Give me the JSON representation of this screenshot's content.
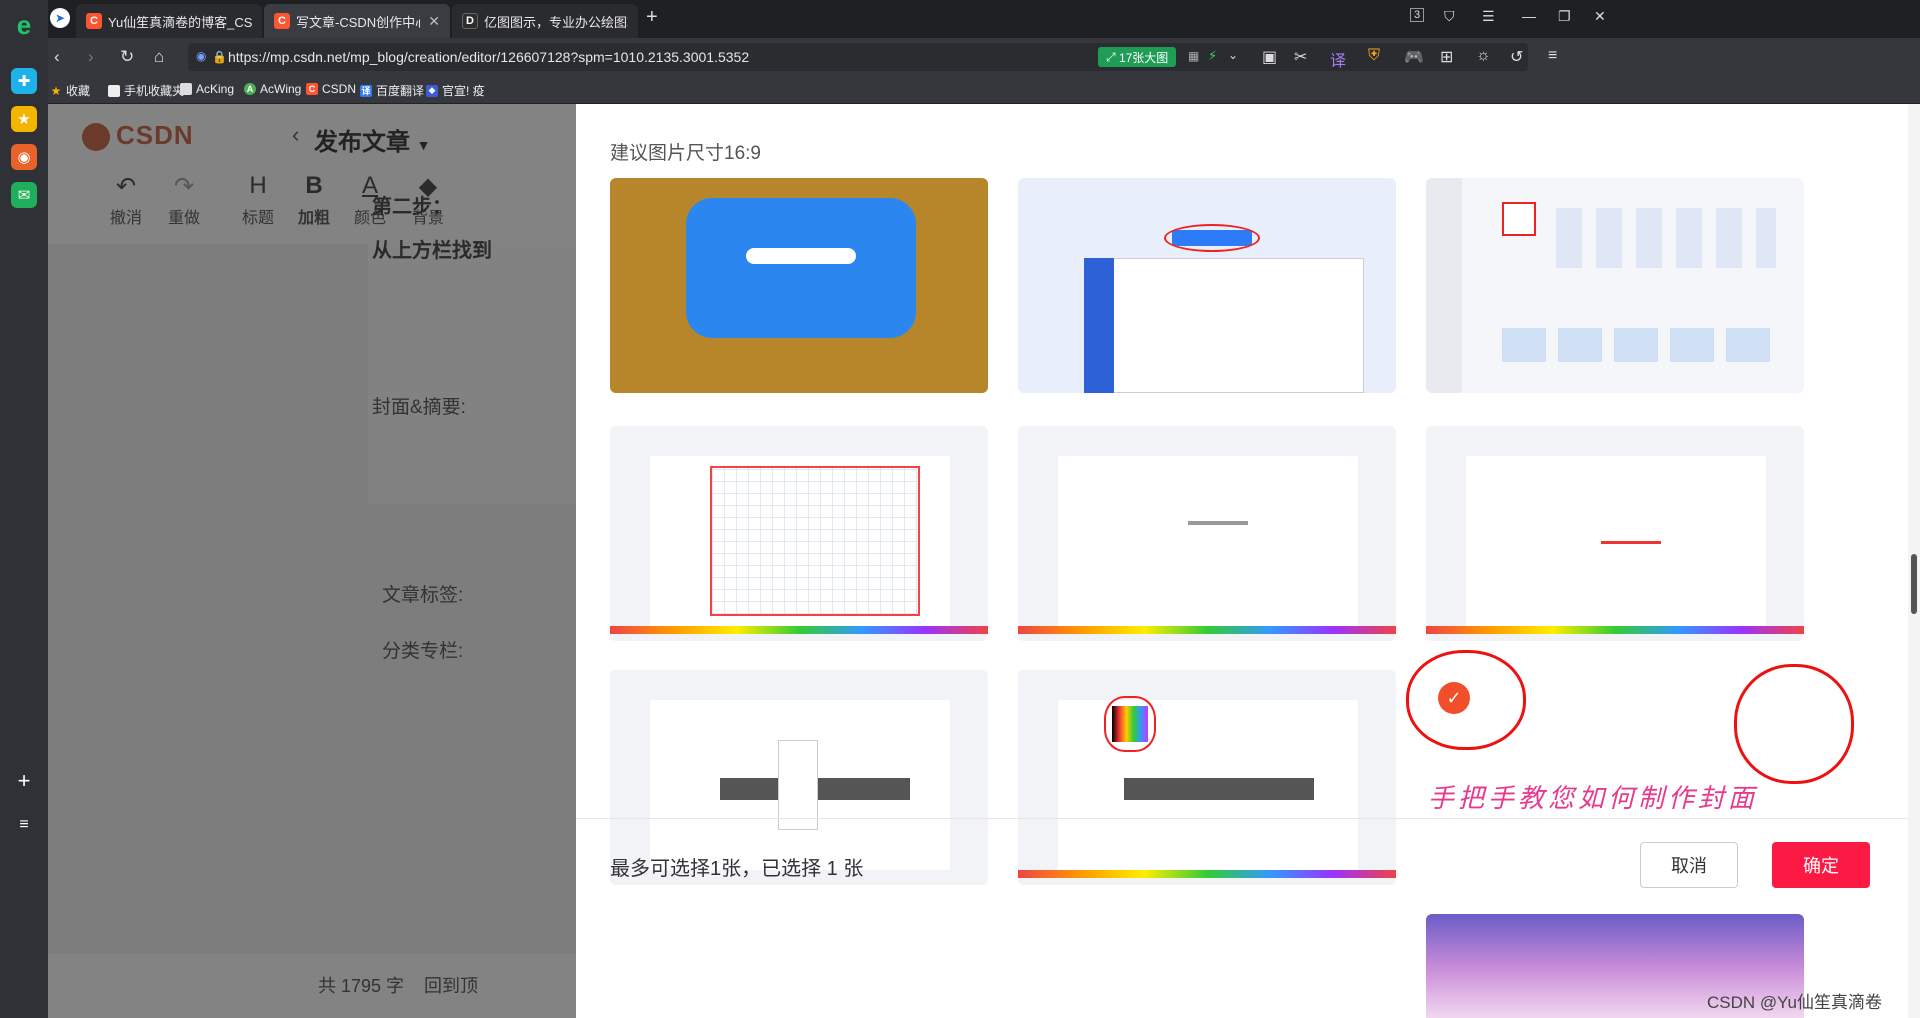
{
  "browser": {
    "tabs": [
      {
        "label": "Yu仙笙真滴卷的博客_CSDN博客",
        "favicon": "C",
        "color": "#fc5531"
      },
      {
        "label": "写文章-CSDN创作中心",
        "favicon": "C",
        "color": "#fc5531"
      },
      {
        "label": "亿图图示，专业办公绘图软件",
        "favicon": "D",
        "color": "#2d2d2d"
      }
    ],
    "tab_count": "3",
    "url": "https://mp.csdn.net/mp_blog/creation/editor/126607128?spm=1010.2135.3001.5352",
    "image_badge": "17张大图",
    "bookmarks": [
      "收藏",
      "手机收藏夹",
      "AcKing",
      "AcWing",
      "CSDN",
      "百度翻译",
      "官宣! 疫"
    ]
  },
  "editor": {
    "logo": "CSDN",
    "page_title": "发布文章",
    "toolbar": [
      {
        "icon": "undo-icon",
        "glyph": "↶",
        "label": "撤消"
      },
      {
        "icon": "redo-icon",
        "glyph": "↷",
        "label": "重做"
      },
      {
        "icon": "heading-icon",
        "glyph": "H",
        "label": "标题"
      },
      {
        "icon": "bold-icon",
        "glyph": "B",
        "label": "加粗"
      },
      {
        "icon": "color-icon",
        "glyph": "A",
        "label": "颜色"
      },
      {
        "icon": "background-icon",
        "glyph": "◆",
        "label": "背景"
      }
    ],
    "body_lines": [
      "第二步：",
      "从上方栏找到"
    ],
    "labels": {
      "cover": "封面&摘要:",
      "tags": "文章标签:",
      "category": "分类专栏:"
    },
    "footer": {
      "word_count": "共 1795 字",
      "back_top": "回到顶"
    }
  },
  "modal": {
    "hint": "建议图片尺寸16:9",
    "footer_text": "最多可选择1张，已选择 1 张",
    "cancel": "取消",
    "confirm": "确定",
    "annotation": "手把手教您如何制作封面"
  },
  "watermark": "CSDN @Yu仙笙真滴卷"
}
